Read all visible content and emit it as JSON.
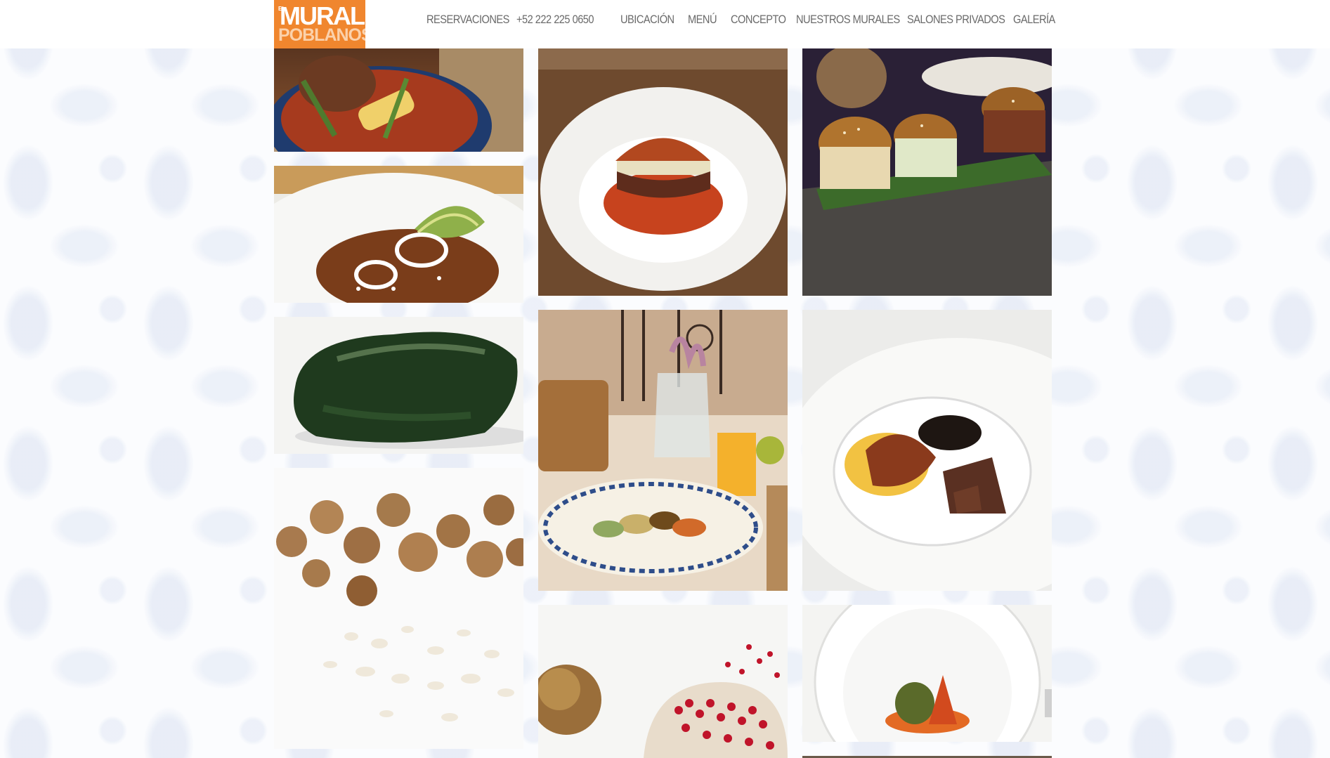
{
  "brand": {
    "logo_small": "EL",
    "logo_main": "MURAL",
    "logo_sub": "POBLANOS"
  },
  "nav": [
    {
      "label": "RESERVACIONES"
    },
    {
      "label": "+52 222 225 0650"
    },
    {
      "label": "UBICACIÓN"
    },
    {
      "label": "MENÚ"
    },
    {
      "label": "CONCEPTO"
    },
    {
      "label": "NUESTROS MURALES"
    },
    {
      "label": "SALONES PRIVADOS"
    },
    {
      "label": "GALERÍA"
    }
  ],
  "colors": {
    "brand_orange": "#f0862e",
    "nav_text": "#6a6a6a",
    "page_background": "#fbfcfe"
  },
  "gallery": [
    {
      "subject": "mole-stew-pot"
    },
    {
      "subject": "chilaquiles-plate"
    },
    {
      "subject": "poblano-pepper"
    },
    {
      "subject": "walnuts"
    },
    {
      "subject": "pambazo-plate"
    },
    {
      "subject": "breakfast-table"
    },
    {
      "subject": "pomegranate"
    },
    {
      "subject": "sliders-platter"
    },
    {
      "subject": "eggs-beans-plate"
    },
    {
      "subject": "stuffed-dish-bowl"
    },
    {
      "subject": "partial-tile"
    }
  ]
}
